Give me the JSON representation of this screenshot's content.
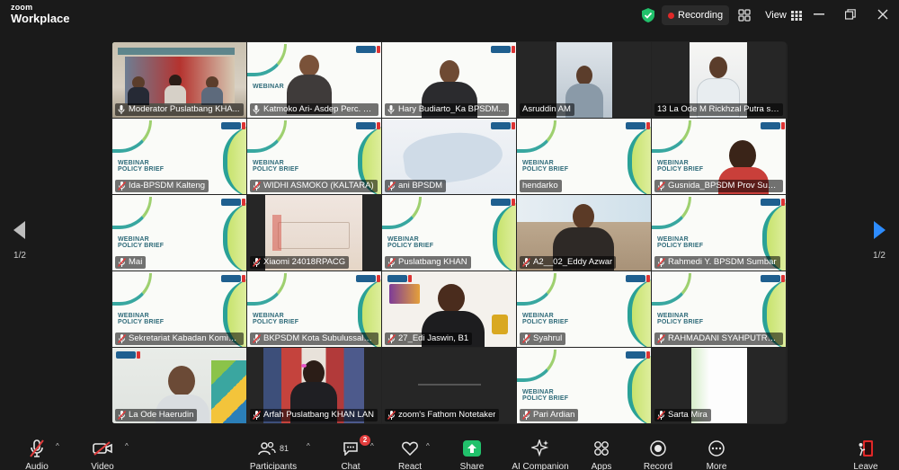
{
  "app": {
    "title_line1": "zoom",
    "title_line2": "Workplace"
  },
  "header": {
    "recording_label": "Recording",
    "view_label": "View"
  },
  "pager": {
    "left_label": "1/2",
    "right_label": "1/2"
  },
  "colors": {
    "accent": "#3fc94a",
    "recording": "#e02828",
    "share": "#21c16b",
    "leave": "#e02828",
    "next_arrow": "#2d8cff"
  },
  "tiles": [
    {
      "name": "Moderator Puslatbang KHA..."
    },
    {
      "name": "Katmoko Ari-  Asdep Perc. Tr..."
    },
    {
      "name": "Hary Budiarto_Ka BPSDM..."
    },
    {
      "name": "Asruddin AM"
    },
    {
      "name": "13 La Ode M Rickhzal Putra set..."
    },
    {
      "name": "Ida-BPSDM Kalteng"
    },
    {
      "name": "WIDHI ASMOKO (KALTARA)"
    },
    {
      "name": "ani BPSDM"
    },
    {
      "name": "hendarko"
    },
    {
      "name": "Gusnida_BPSDM Prov Sumb..."
    },
    {
      "name": "Mai"
    },
    {
      "name": "Xiaomi 24018RPACG"
    },
    {
      "name": "Puslatbang KHAN"
    },
    {
      "name": "A2__02_Eddy Azwar"
    },
    {
      "name": "Rahmedi Y. BPSDM Sumbar"
    },
    {
      "name": "Sekretariat Kabadan Kominfo"
    },
    {
      "name": "BKPSDM Kota Subulussalam"
    },
    {
      "name": "27_Edi Jaswin, B1"
    },
    {
      "name": "Syahrul"
    },
    {
      "name": "RAHMADANI SYAHPUTRA, S..."
    },
    {
      "name": "La Ode Haerudin"
    },
    {
      "name": "Arfah Puslatbang KHAN LAN"
    },
    {
      "name": "zoom's Fathom Notetaker"
    },
    {
      "name": "Pari Ardian"
    },
    {
      "name": "Sarta Mira"
    }
  ],
  "webinar_text": {
    "line1": "WEBINAR",
    "line2": "POLICY BRIEF"
  },
  "toolbar": {
    "audio": "Audio",
    "video": "Video",
    "participants": "Participants",
    "participants_count": "81",
    "chat": "Chat",
    "chat_badge": "2",
    "react": "React",
    "share": "Share",
    "ai_companion": "AI Companion",
    "apps": "Apps",
    "record": "Record",
    "more": "More",
    "leave": "Leave"
  }
}
